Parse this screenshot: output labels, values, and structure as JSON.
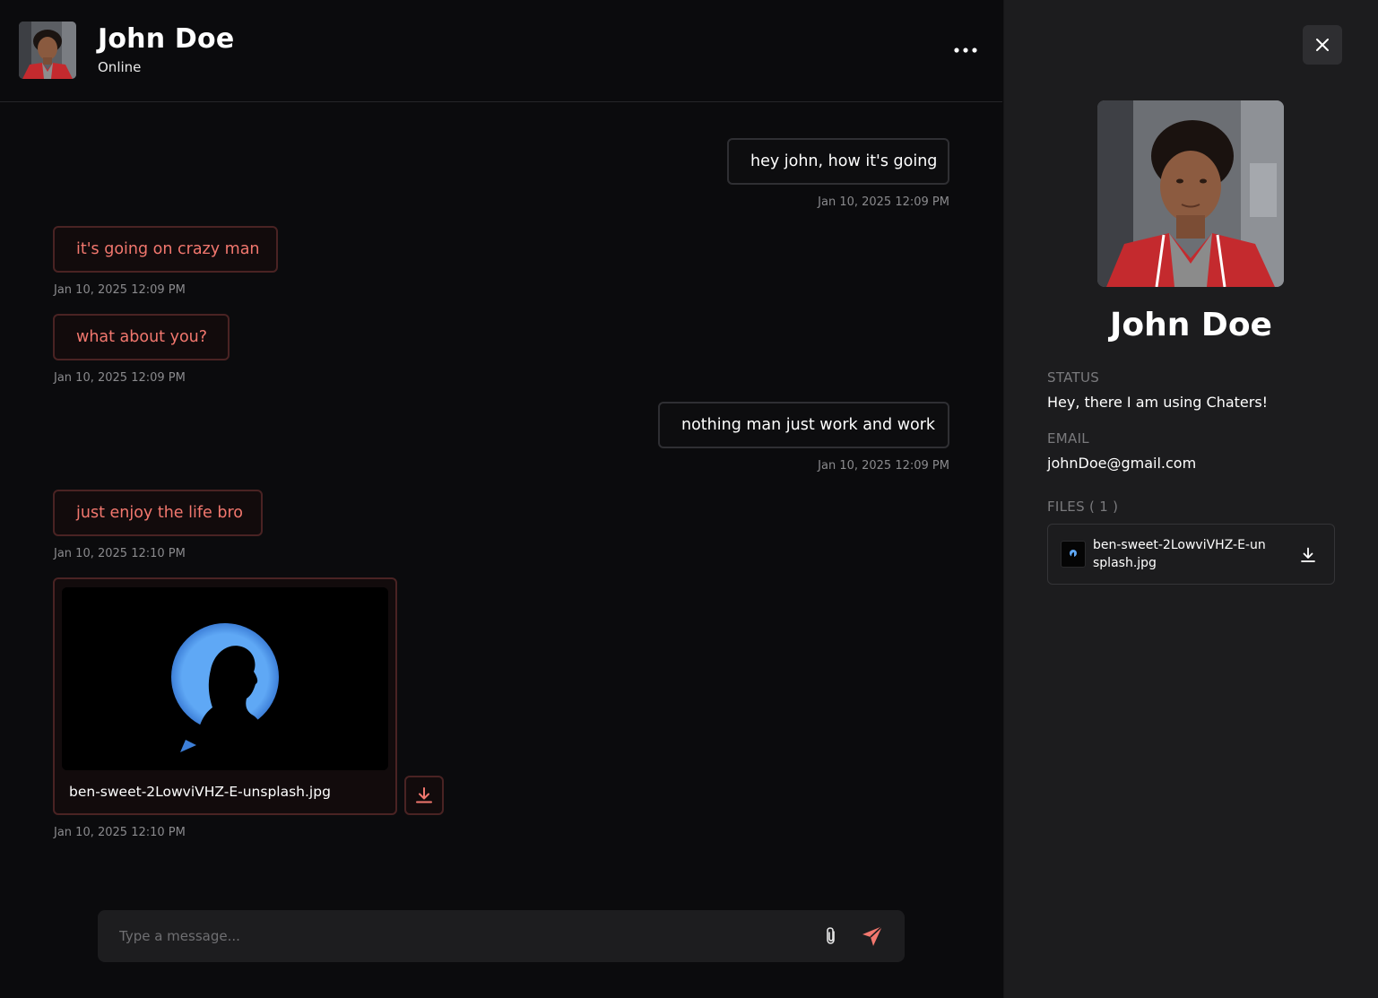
{
  "header": {
    "name": "John Doe",
    "status": "Online"
  },
  "messages": [
    {
      "side": "sent",
      "text": "hey john, how it's going",
      "time": "Jan 10, 2025 12:09 PM"
    },
    {
      "side": "recv",
      "text": "it's going on crazy man",
      "time": "Jan 10, 2025 12:09 PM"
    },
    {
      "side": "recv",
      "text": "what about you?",
      "time": "Jan 10, 2025 12:09 PM"
    },
    {
      "side": "sent",
      "text": "nothing man just work and work",
      "time": "Jan 10, 2025 12:09 PM"
    },
    {
      "side": "recv",
      "text": "just enjoy the life bro",
      "time": "Jan 10, 2025 12:10 PM"
    },
    {
      "side": "recv",
      "type": "file",
      "file_name": "ben-sweet-2LowviVHZ-E-unsplash.jpg",
      "time": "Jan 10, 2025 12:10 PM"
    }
  ],
  "composer": {
    "placeholder": "Type a message..."
  },
  "profile": {
    "name": "John Doe",
    "status_label": "STATUS",
    "status_value": "Hey, there I am using Chaters!",
    "email_label": "EMAIL",
    "email_value": "johnDoe@gmail.com",
    "files_label": "FILES ( 1 )",
    "files": [
      {
        "name": "ben-sweet-2LowviVHZ-E-unsplash.jpg"
      }
    ]
  },
  "colors": {
    "accent": "#f2776e",
    "background": "#0b0b0d",
    "panel": "#1c1c1e"
  }
}
